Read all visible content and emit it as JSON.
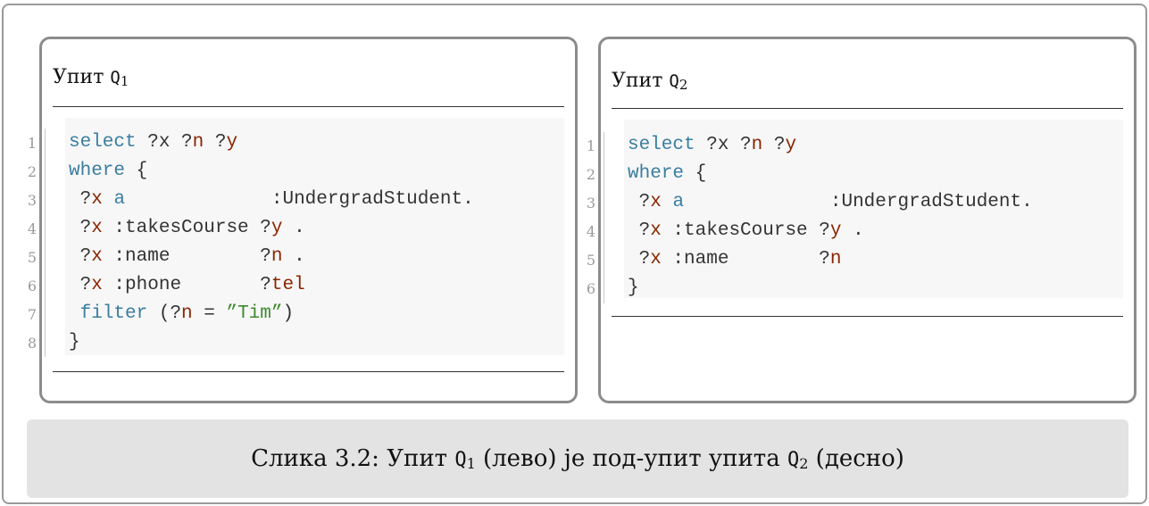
{
  "q1": {
    "title_word": "Упит",
    "symbol": "Q",
    "subscript": "1",
    "lines": [
      {
        "num": "1",
        "segments": [
          {
            "t": "select",
            "c": "kw"
          },
          {
            "t": " ?x ?",
            "c": ""
          },
          {
            "t": "n",
            "c": "var"
          },
          {
            "t": " ?",
            "c": ""
          },
          {
            "t": "y",
            "c": "var"
          }
        ]
      },
      {
        "num": "2",
        "segments": [
          {
            "t": "where",
            "c": "kw"
          },
          {
            "t": " {",
            "c": ""
          }
        ]
      },
      {
        "num": "3",
        "segments": [
          {
            "t": " ?",
            "c": ""
          },
          {
            "t": "x",
            "c": "var"
          },
          {
            "t": " ",
            "c": ""
          },
          {
            "t": "a",
            "c": "kw"
          },
          {
            "t": "             :UndergradStudent.",
            "c": ""
          }
        ]
      },
      {
        "num": "4",
        "segments": [
          {
            "t": " ?",
            "c": ""
          },
          {
            "t": "x",
            "c": "var"
          },
          {
            "t": " :takesCourse ?",
            "c": ""
          },
          {
            "t": "y",
            "c": "var"
          },
          {
            "t": " .",
            "c": ""
          }
        ]
      },
      {
        "num": "5",
        "segments": [
          {
            "t": " ?",
            "c": ""
          },
          {
            "t": "x",
            "c": "var"
          },
          {
            "t": " :name        ?",
            "c": ""
          },
          {
            "t": "n",
            "c": "var"
          },
          {
            "t": " .",
            "c": ""
          }
        ]
      },
      {
        "num": "6",
        "segments": [
          {
            "t": " ?",
            "c": ""
          },
          {
            "t": "x",
            "c": "var"
          },
          {
            "t": " :phone       ?",
            "c": ""
          },
          {
            "t": "tel",
            "c": "var"
          }
        ]
      },
      {
        "num": "7",
        "segments": [
          {
            "t": " ",
            "c": ""
          },
          {
            "t": "filter",
            "c": "kw"
          },
          {
            "t": " (?",
            "c": ""
          },
          {
            "t": "n",
            "c": "var"
          },
          {
            "t": " = ",
            "c": ""
          },
          {
            "t": "”Tim”",
            "c": "str"
          },
          {
            "t": ")",
            "c": ""
          }
        ]
      },
      {
        "num": "8",
        "segments": [
          {
            "t": "}",
            "c": ""
          }
        ]
      }
    ]
  },
  "q2": {
    "title_word": "Упит",
    "symbol": "Q",
    "subscript": "2",
    "lines": [
      {
        "num": "1",
        "segments": [
          {
            "t": "select",
            "c": "kw"
          },
          {
            "t": " ?x ?",
            "c": ""
          },
          {
            "t": "n",
            "c": "var"
          },
          {
            "t": " ?",
            "c": ""
          },
          {
            "t": "y",
            "c": "var"
          }
        ]
      },
      {
        "num": "2",
        "segments": [
          {
            "t": "where",
            "c": "kw"
          },
          {
            "t": " {",
            "c": ""
          }
        ]
      },
      {
        "num": "3",
        "segments": [
          {
            "t": " ?",
            "c": ""
          },
          {
            "t": "x",
            "c": "var"
          },
          {
            "t": " ",
            "c": ""
          },
          {
            "t": "a",
            "c": "kw"
          },
          {
            "t": "             :UndergradStudent.",
            "c": ""
          }
        ]
      },
      {
        "num": "4",
        "segments": [
          {
            "t": " ?",
            "c": ""
          },
          {
            "t": "x",
            "c": "var"
          },
          {
            "t": " :takesCourse ?",
            "c": ""
          },
          {
            "t": "y",
            "c": "var"
          },
          {
            "t": " .",
            "c": ""
          }
        ]
      },
      {
        "num": "5",
        "segments": [
          {
            "t": " ?",
            "c": ""
          },
          {
            "t": "x",
            "c": "var"
          },
          {
            "t": " :name        ?",
            "c": ""
          },
          {
            "t": "n",
            "c": "var"
          }
        ]
      },
      {
        "num": "6",
        "segments": [
          {
            "t": "}",
            "c": ""
          }
        ]
      }
    ]
  },
  "caption": {
    "prefix": "Слика 3.2: Упит ",
    "sym1": "Q",
    "sub1": "1",
    "middle": " (лево) је под-упит упита ",
    "sym2": "Q",
    "sub2": "2",
    "suffix": " (десно)"
  },
  "colors": {
    "keyword": "#3a7da0",
    "variable": "#8b2500",
    "string": "#3e8a2e",
    "plain": "#333333"
  }
}
